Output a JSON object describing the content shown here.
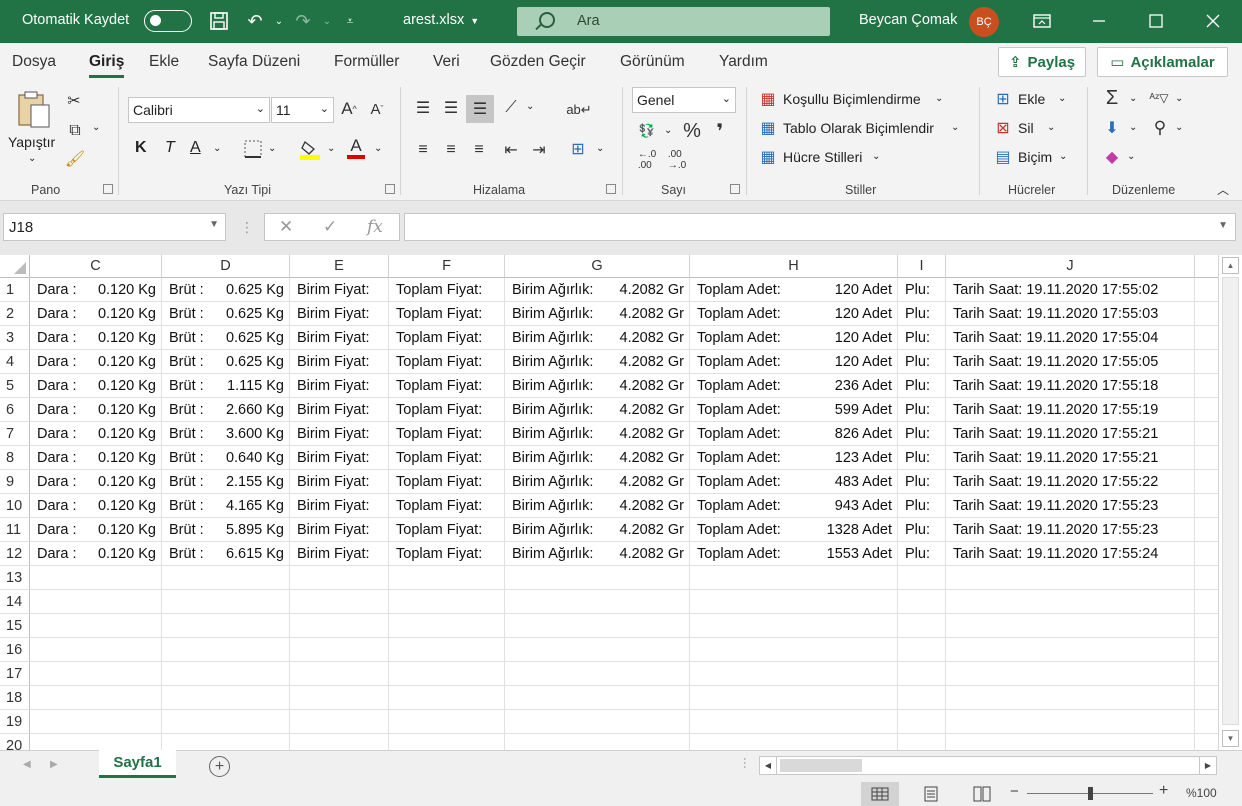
{
  "titlebar": {
    "autosave_label": "Otomatik Kaydet",
    "filename": "arest.xlsx",
    "search_placeholder": "Ara",
    "user_name": "Beycan Çomak",
    "user_initials": "BÇ",
    "accent_color": "#217346"
  },
  "tabs": [
    "Dosya",
    "Giriş",
    "Ekle",
    "Sayfa Düzeni",
    "Formüller",
    "Veri",
    "Gözden Geçir",
    "Görünüm",
    "Yardım"
  ],
  "active_tab": "Giriş",
  "share_label": "Paylaş",
  "comments_label": "Açıklamalar",
  "ribbon": {
    "groups": {
      "pano": "Pano",
      "font": "Yazı Tipi",
      "alignment": "Hizalama",
      "number": "Sayı",
      "styles": "Stiller",
      "cells": "Hücreler",
      "editing": "Düzenleme"
    },
    "paste_label": "Yapıştır",
    "font_name": "Calibri",
    "font_size": "11",
    "bold": "K",
    "italic": "T",
    "underline": "A",
    "font_color_letter": "A",
    "number_format": "Genel",
    "conditional_formatting": "Koşullu Biçimlendirme",
    "format_as_table": "Tablo Olarak Biçimlendir",
    "cell_styles": "Hücre Stilleri",
    "insert": "Ekle",
    "delete": "Sil",
    "format": "Biçim",
    "highlight_color": "#ffff00",
    "font_color": "#e00000"
  },
  "formula_bar": {
    "name_box": "J18",
    "fx": "fx",
    "value": ""
  },
  "columns": [
    "C",
    "D",
    "E",
    "F",
    "G",
    "H",
    "I",
    "J"
  ],
  "rows": [
    {
      "num": "1",
      "c": [
        "Dara :",
        "0.120 Kg"
      ],
      "d": [
        "Brüt :",
        "0.625 Kg"
      ],
      "e": "Birim Fiyat:",
      "f": "Toplam Fiyat:",
      "g": [
        "Birim Ağırlık:",
        "4.2082 Gr"
      ],
      "h": [
        "Toplam Adet:",
        "120 Adet"
      ],
      "i": "Plu:",
      "j": "Tarih Saat: 19.11.2020 17:55:02"
    },
    {
      "num": "2",
      "c": [
        "Dara :",
        "0.120 Kg"
      ],
      "d": [
        "Brüt :",
        "0.625 Kg"
      ],
      "e": "Birim Fiyat:",
      "f": "Toplam Fiyat:",
      "g": [
        "Birim Ağırlık:",
        "4.2082 Gr"
      ],
      "h": [
        "Toplam Adet:",
        "120 Adet"
      ],
      "i": "Plu:",
      "j": "Tarih Saat: 19.11.2020 17:55:03"
    },
    {
      "num": "3",
      "c": [
        "Dara :",
        "0.120 Kg"
      ],
      "d": [
        "Brüt :",
        "0.625 Kg"
      ],
      "e": "Birim Fiyat:",
      "f": "Toplam Fiyat:",
      "g": [
        "Birim Ağırlık:",
        "4.2082 Gr"
      ],
      "h": [
        "Toplam Adet:",
        "120 Adet"
      ],
      "i": "Plu:",
      "j": "Tarih Saat: 19.11.2020 17:55:04"
    },
    {
      "num": "4",
      "c": [
        "Dara :",
        "0.120 Kg"
      ],
      "d": [
        "Brüt :",
        "0.625 Kg"
      ],
      "e": "Birim Fiyat:",
      "f": "Toplam Fiyat:",
      "g": [
        "Birim Ağırlık:",
        "4.2082 Gr"
      ],
      "h": [
        "Toplam Adet:",
        "120 Adet"
      ],
      "i": "Plu:",
      "j": "Tarih Saat: 19.11.2020 17:55:05"
    },
    {
      "num": "5",
      "c": [
        "Dara :",
        "0.120 Kg"
      ],
      "d": [
        "Brüt :",
        "1.115 Kg"
      ],
      "e": "Birim Fiyat:",
      "f": "Toplam Fiyat:",
      "g": [
        "Birim Ağırlık:",
        "4.2082 Gr"
      ],
      "h": [
        "Toplam Adet:",
        "236 Adet"
      ],
      "i": "Plu:",
      "j": "Tarih Saat: 19.11.2020 17:55:18"
    },
    {
      "num": "6",
      "c": [
        "Dara :",
        "0.120 Kg"
      ],
      "d": [
        "Brüt :",
        "2.660 Kg"
      ],
      "e": "Birim Fiyat:",
      "f": "Toplam Fiyat:",
      "g": [
        "Birim Ağırlık:",
        "4.2082 Gr"
      ],
      "h": [
        "Toplam Adet:",
        "599 Adet"
      ],
      "i": "Plu:",
      "j": "Tarih Saat: 19.11.2020 17:55:19"
    },
    {
      "num": "7",
      "c": [
        "Dara :",
        "0.120 Kg"
      ],
      "d": [
        "Brüt :",
        "3.600 Kg"
      ],
      "e": "Birim Fiyat:",
      "f": "Toplam Fiyat:",
      "g": [
        "Birim Ağırlık:",
        "4.2082 Gr"
      ],
      "h": [
        "Toplam Adet:",
        "826 Adet"
      ],
      "i": "Plu:",
      "j": "Tarih Saat: 19.11.2020 17:55:21"
    },
    {
      "num": "8",
      "c": [
        "Dara :",
        "0.120 Kg"
      ],
      "d": [
        "Brüt :",
        "0.640 Kg"
      ],
      "e": "Birim Fiyat:",
      "f": "Toplam Fiyat:",
      "g": [
        "Birim Ağırlık:",
        "4.2082 Gr"
      ],
      "h": [
        "Toplam Adet:",
        "123 Adet"
      ],
      "i": "Plu:",
      "j": "Tarih Saat: 19.11.2020 17:55:21"
    },
    {
      "num": "9",
      "c": [
        "Dara :",
        "0.120 Kg"
      ],
      "d": [
        "Brüt :",
        "2.155 Kg"
      ],
      "e": "Birim Fiyat:",
      "f": "Toplam Fiyat:",
      "g": [
        "Birim Ağırlık:",
        "4.2082 Gr"
      ],
      "h": [
        "Toplam Adet:",
        "483 Adet"
      ],
      "i": "Plu:",
      "j": "Tarih Saat: 19.11.2020 17:55:22"
    },
    {
      "num": "10",
      "c": [
        "Dara :",
        "0.120 Kg"
      ],
      "d": [
        "Brüt :",
        "4.165 Kg"
      ],
      "e": "Birim Fiyat:",
      "f": "Toplam Fiyat:",
      "g": [
        "Birim Ağırlık:",
        "4.2082 Gr"
      ],
      "h": [
        "Toplam Adet:",
        "943 Adet"
      ],
      "i": "Plu:",
      "j": "Tarih Saat: 19.11.2020 17:55:23"
    },
    {
      "num": "11",
      "c": [
        "Dara :",
        "0.120 Kg"
      ],
      "d": [
        "Brüt :",
        "5.895 Kg"
      ],
      "e": "Birim Fiyat:",
      "f": "Toplam Fiyat:",
      "g": [
        "Birim Ağırlık:",
        "4.2082 Gr"
      ],
      "h": [
        "Toplam Adet:",
        "1328 Adet"
      ],
      "i": "Plu:",
      "j": "Tarih Saat: 19.11.2020 17:55:23"
    },
    {
      "num": "12",
      "c": [
        "Dara :",
        "0.120 Kg"
      ],
      "d": [
        "Brüt :",
        "6.615 Kg"
      ],
      "e": "Birim Fiyat:",
      "f": "Toplam Fiyat:",
      "g": [
        "Birim Ağırlık:",
        "4.2082 Gr"
      ],
      "h": [
        "Toplam Adet:",
        "1553 Adet"
      ],
      "i": "Plu:",
      "j": "Tarih Saat: 19.11.2020 17:55:24"
    }
  ],
  "empty_rows": [
    "13",
    "14",
    "15",
    "16",
    "17",
    "18",
    "19",
    "20"
  ],
  "sheet_tab": "Sayfa1",
  "zoom": "%100"
}
